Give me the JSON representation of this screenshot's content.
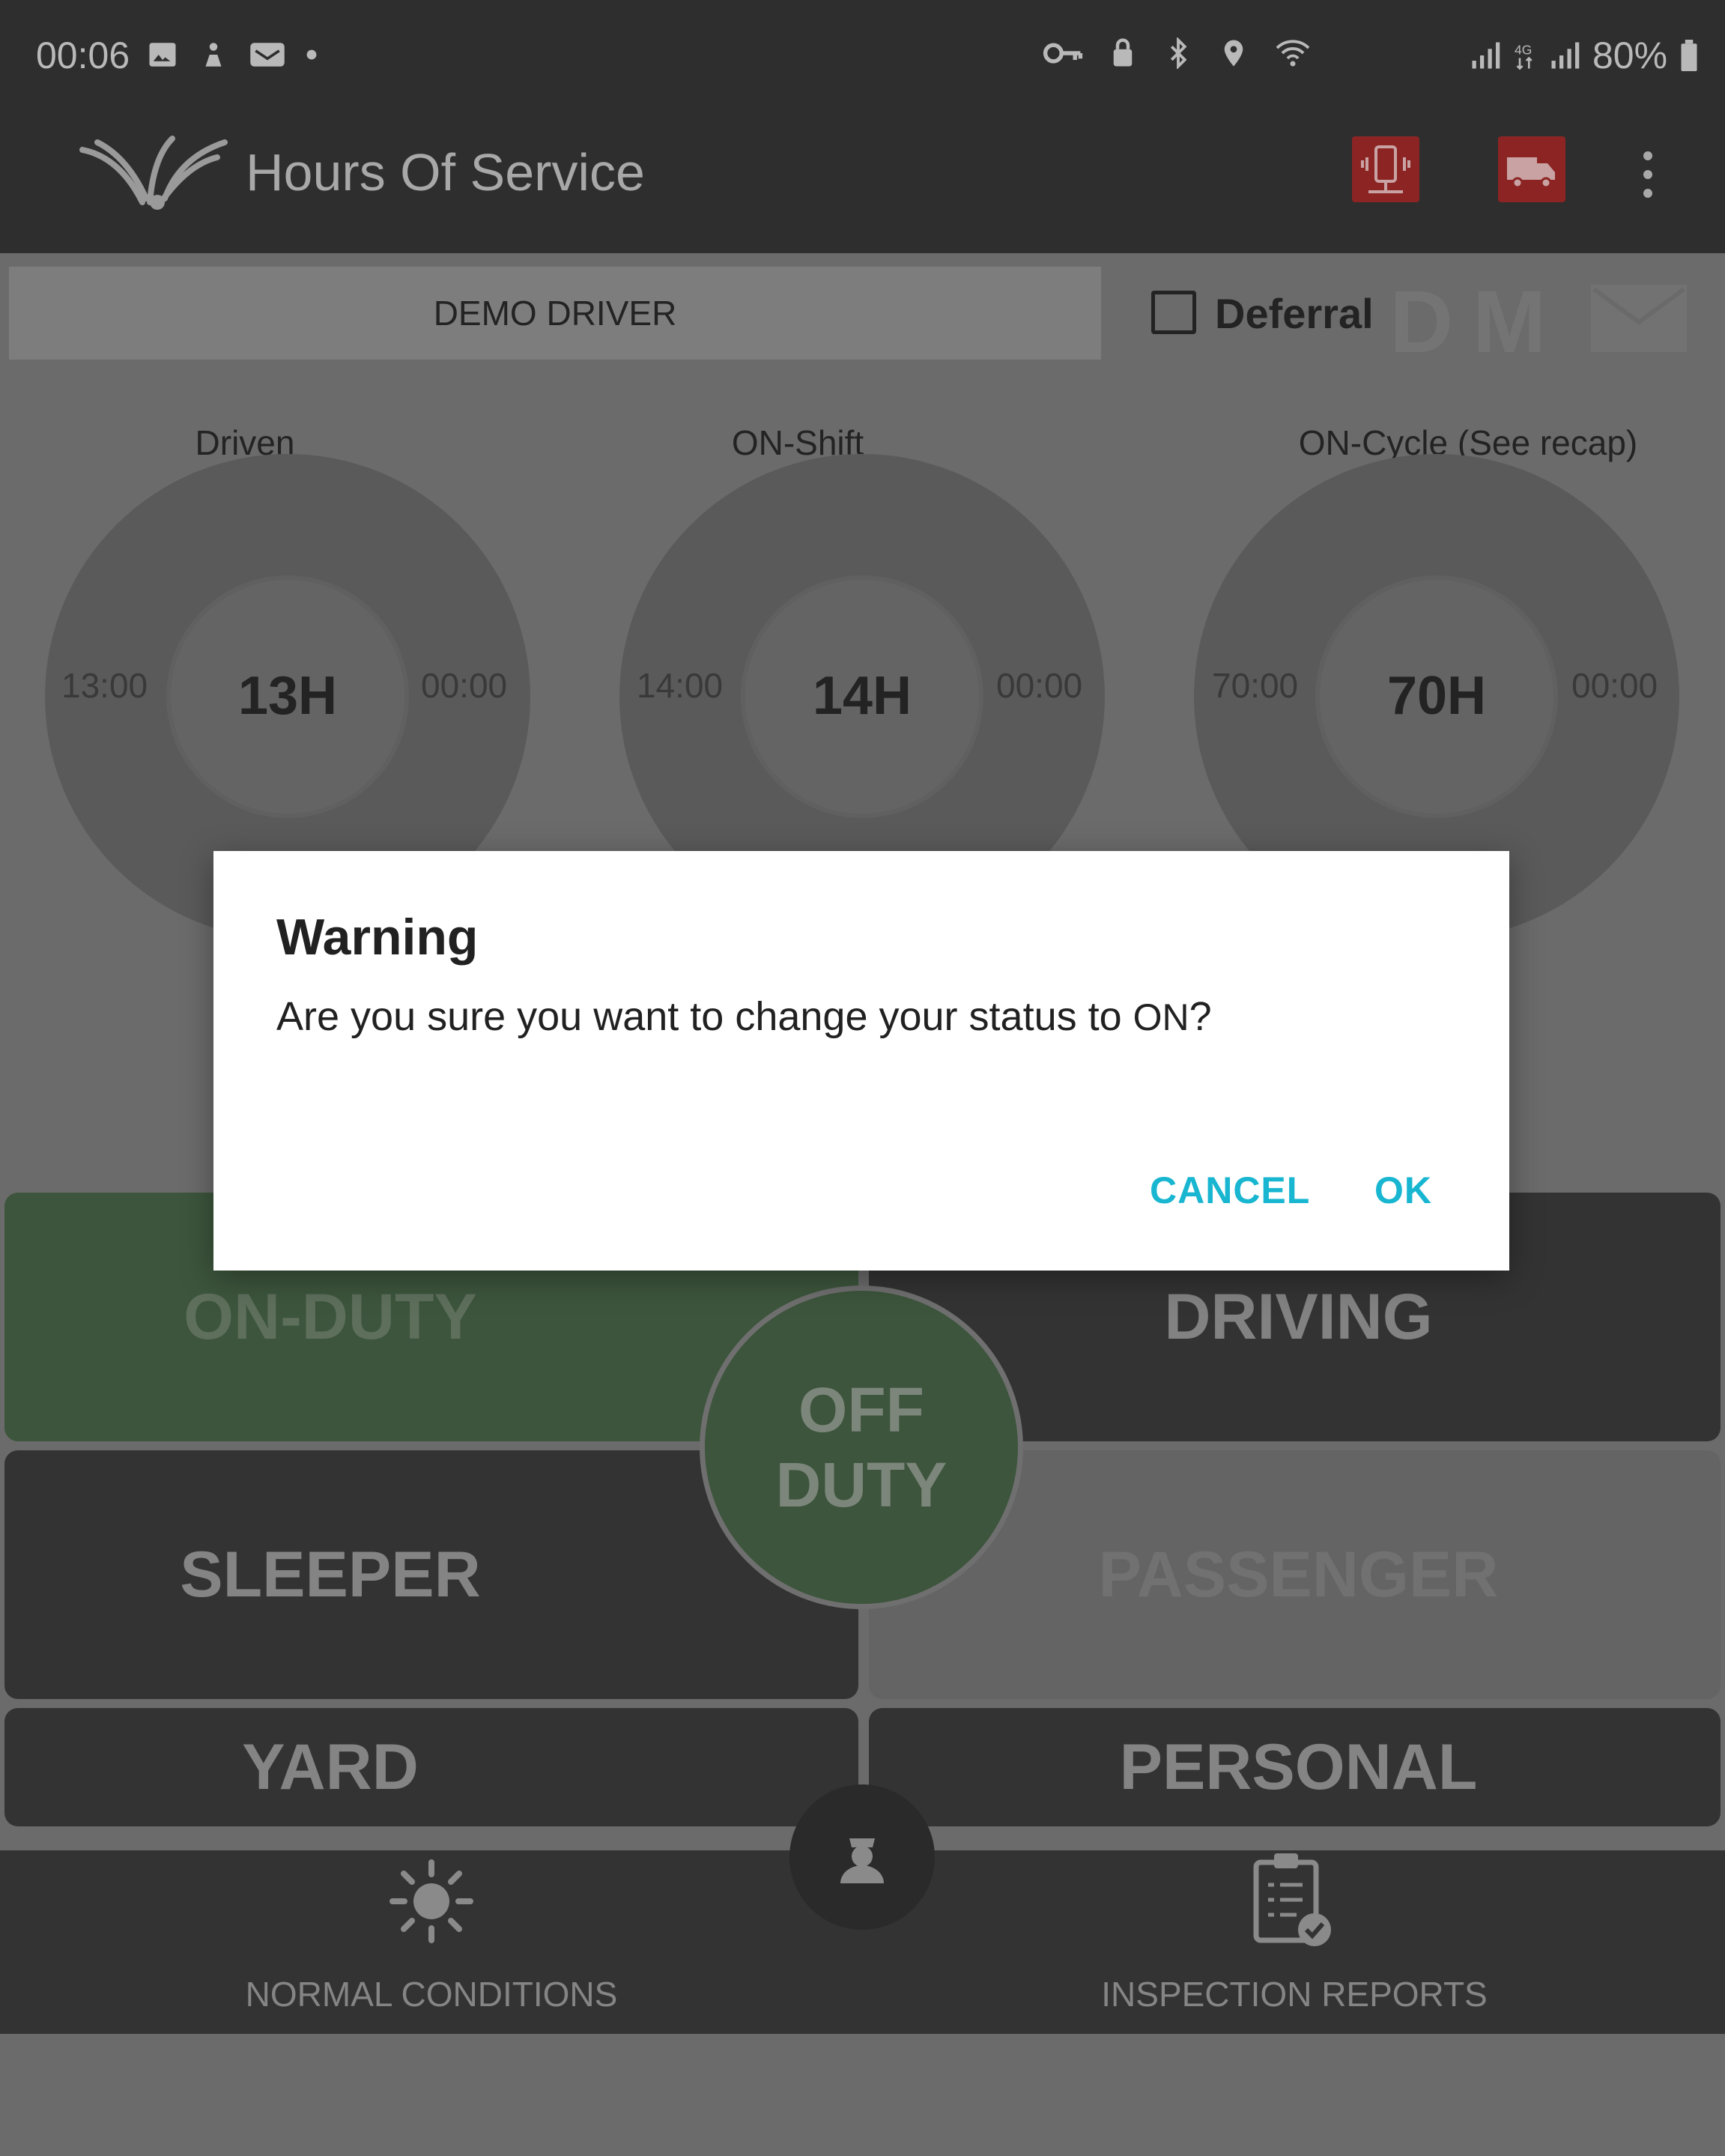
{
  "status_bar": {
    "time": "00:06",
    "battery": "80%",
    "icons_left": [
      "gallery-icon",
      "notification-icon",
      "mail-app-icon",
      "dot-icon"
    ],
    "icons_mid": [
      "vpn-key-icon",
      "lock-icon",
      "bluetooth-icon",
      "location-icon",
      "wifi-icon"
    ],
    "icons_right": [
      "signal-icon",
      "4g-icon",
      "signal-icon",
      "battery-icon"
    ]
  },
  "app_bar": {
    "title": "Hours Of Service",
    "actions": [
      "device-connection-icon",
      "truck-icon",
      "overflow-menu-icon"
    ],
    "action_color": "#8c2424"
  },
  "driver": {
    "name": "DEMO DRIVER",
    "deferral_label": "Deferral",
    "deferral_checked": false,
    "mode_letters": [
      "D",
      "M"
    ]
  },
  "gauges": [
    {
      "title": "Driven",
      "left": "13:00",
      "center": "13H",
      "right": "00:00"
    },
    {
      "title": "ON-Shift",
      "left": "14:00",
      "center": "14H",
      "right": "00:00"
    },
    {
      "title": "ON-Cycle (See recap)",
      "left": "70:00",
      "center": "70H",
      "right": "00:00"
    }
  ],
  "status_buttons": {
    "on_duty": "ON-DUTY",
    "driving": "DRIVING",
    "off_duty_line1": "OFF",
    "off_duty_line2": "DUTY",
    "sleeper": "SLEEPER",
    "passenger": "PASSENGER",
    "yard": "YARD",
    "personal": "PERSONAL",
    "active_color": "#3d553c"
  },
  "bottom_nav": {
    "left_label": "NORMAL CONDITIONS",
    "right_label": "INSPECTION REPORTS",
    "center_icon": "officer-icon"
  },
  "dialog": {
    "title": "Warning",
    "message": "Are you sure you want to change your status to ",
    "status": "ON",
    "message_end": "?",
    "cancel": "CANCEL",
    "ok": "OK",
    "button_color": "#19b6d1"
  }
}
